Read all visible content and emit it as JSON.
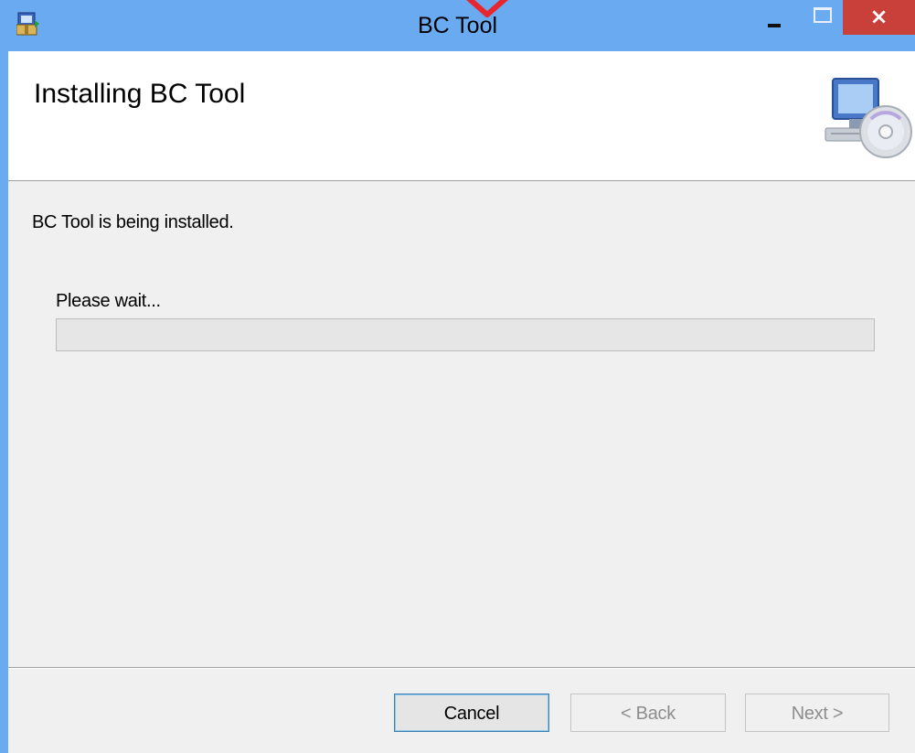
{
  "window": {
    "title": "BC Tool",
    "close_glyph": "×",
    "app_icon": "installer-package-icon",
    "annotation_color": "#e8262e"
  },
  "banner": {
    "title": "Installing BC Tool",
    "icon": "computer-disc-setup-icon"
  },
  "body": {
    "status": "BC Tool is being installed.",
    "wait_label": "Please wait...",
    "progress_percent": 0
  },
  "footer": {
    "cancel_label": "Cancel",
    "back_label": "< Back",
    "next_label": "Next >"
  },
  "colors": {
    "titlebar": "#6aaaf0",
    "close_button": "#c9403a",
    "client": "#f0f0f0"
  }
}
